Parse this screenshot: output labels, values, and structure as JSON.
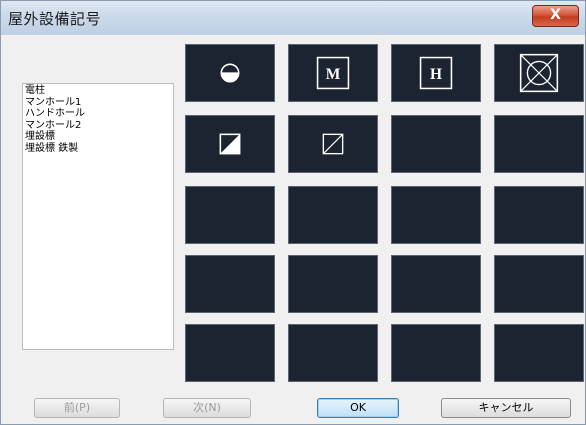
{
  "window": {
    "title": "屋外設備記号",
    "close_label": "X"
  },
  "symbol_list": {
    "items": [
      "電柱",
      "マンホール1",
      "ハンドホール",
      "マンホール2",
      "埋設標",
      "埋設標 鉄製"
    ]
  },
  "symbol_grid": {
    "columns": 4,
    "rows": 5,
    "symbols": [
      {
        "row": 0,
        "col": 0,
        "icon": "half-filled-circle-icon"
      },
      {
        "row": 0,
        "col": 1,
        "icon": "boxed-letter-m-icon",
        "text": "M"
      },
      {
        "row": 0,
        "col": 2,
        "icon": "boxed-letter-h-icon",
        "text": "H"
      },
      {
        "row": 0,
        "col": 3,
        "icon": "crossed-box-circle-icon"
      },
      {
        "row": 1,
        "col": 0,
        "icon": "diagonal-half-filled-square-icon"
      },
      {
        "row": 1,
        "col": 1,
        "icon": "diagonal-square-icon"
      }
    ]
  },
  "buttons": {
    "prev_label": "前(P)",
    "next_label": "次(N)",
    "ok_label": "OK",
    "cancel_label": "キャンセル"
  },
  "colors": {
    "cell_background": "#1c2432",
    "symbol_stroke": "#ffffff"
  }
}
